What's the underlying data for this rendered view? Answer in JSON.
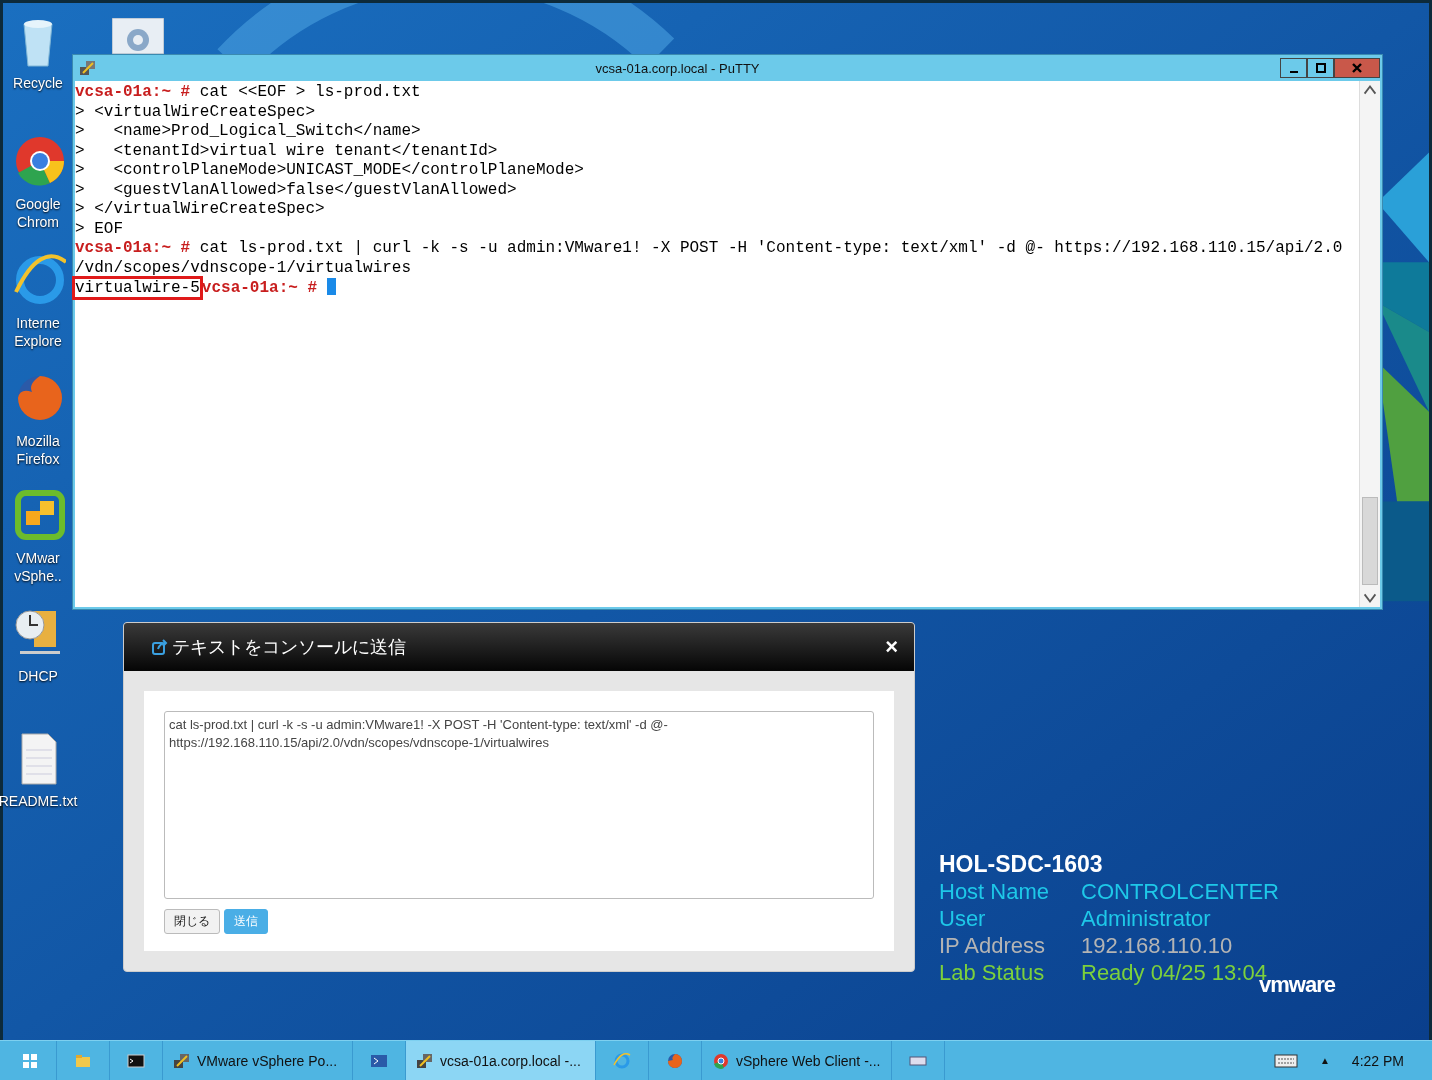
{
  "desktop_icons": [
    {
      "kind": "recycle",
      "label": [
        "Recycle"
      ]
    },
    {
      "kind": "chrome",
      "label": [
        "Google",
        "Chrom"
      ]
    },
    {
      "kind": "ie",
      "label": [
        "Interne",
        "Explore"
      ]
    },
    {
      "kind": "firefox",
      "label": [
        "Mozilla",
        "Firefox"
      ]
    },
    {
      "kind": "vsphere",
      "label": [
        "VMwar",
        "vSphe.."
      ]
    },
    {
      "kind": "dhcp",
      "label": [
        "DHCP"
      ]
    },
    {
      "kind": "text",
      "label": [
        "README.txt"
      ]
    }
  ],
  "putty": {
    "title": "vcsa-01a.corp.local - PuTTY",
    "lines": [
      [
        {
          "kind": "prompt",
          "text": "vcsa-01a:~ # "
        },
        {
          "kind": "text",
          "text": "cat <<EOF > ls-prod.txt"
        }
      ],
      [
        {
          "kind": "text",
          "text": "> <virtualWireCreateSpec>"
        }
      ],
      [
        {
          "kind": "text",
          "text": ">   <name>Prod_Logical_Switch</name>"
        }
      ],
      [
        {
          "kind": "text",
          "text": ">   <tenantId>virtual wire tenant</tenantId>"
        }
      ],
      [
        {
          "kind": "text",
          "text": ">   <controlPlaneMode>UNICAST_MODE</controlPlaneMode>"
        }
      ],
      [
        {
          "kind": "text",
          "text": ">   <guestVlanAllowed>false</guestVlanAllowed>"
        }
      ],
      [
        {
          "kind": "text",
          "text": "> </virtualWireCreateSpec>"
        }
      ],
      [
        {
          "kind": "text",
          "text": "> EOF"
        }
      ],
      [
        {
          "kind": "prompt",
          "text": "vcsa-01a:~ # "
        },
        {
          "kind": "text",
          "text": "cat ls-prod.txt | curl -k -s -u admin:VMware1! -X POST -H 'Content-type: text/xml' -d @- https://192.168.110.15/api/2.0"
        }
      ],
      [
        {
          "kind": "text",
          "text": "/vdn/scopes/vdnscope-1/virtualwires"
        }
      ],
      [
        {
          "kind": "text",
          "text": "virtualwire-5",
          "highlighted": true
        },
        {
          "kind": "prompt",
          "text": "vcsa-01a:~ # "
        },
        {
          "kind": "cursor"
        }
      ]
    ]
  },
  "dialog": {
    "title": "テキストをコンソールに送信",
    "close": "×",
    "text": "cat ls-prod.txt | curl -k -s -u admin:VMware1! -X POST -H 'Content-type: text/xml' -d @- https://192.168.110.15/api/2.0/vdn/scopes/vdnscope-1/virtualwires",
    "buttons": [
      {
        "label": "閉じる",
        "primary": false
      },
      {
        "label": "送信",
        "primary": true
      }
    ]
  },
  "lab_info": {
    "title": "HOL-SDC-1603",
    "rows": [
      {
        "label": "Host Name",
        "value": "CONTROLCENTER",
        "color": "#1ec8e8"
      },
      {
        "label": "User",
        "value": "Administrator",
        "color": "#1ec8e8"
      },
      {
        "label": "IP Address",
        "value": "192.168.110.10",
        "color": "#b4b4b4"
      },
      {
        "label": "Lab Status",
        "value": "Ready 04/25 13:04",
        "color": "#7cd03c"
      }
    ],
    "logo": "vmware"
  },
  "taskbar": {
    "items": [
      {
        "kind": "start",
        "selected": false
      },
      {
        "kind": "explorer",
        "selected": false
      },
      {
        "kind": "cmd",
        "selected": false
      },
      {
        "kind": "powercli",
        "label": "VMware vSphere Po...",
        "selected": false
      },
      {
        "kind": "powershell",
        "selected": false
      },
      {
        "kind": "putty",
        "label": "vcsa-01a.corp.local -...",
        "selected": true
      },
      {
        "kind": "ie",
        "selected": false
      },
      {
        "kind": "firefox",
        "selected": false
      },
      {
        "kind": "chrome",
        "label": "vSphere Web Client -...",
        "selected": false
      },
      {
        "kind": "keyboard",
        "selected": false
      }
    ],
    "tray_arrow": "▲",
    "time": "4:22 PM"
  }
}
